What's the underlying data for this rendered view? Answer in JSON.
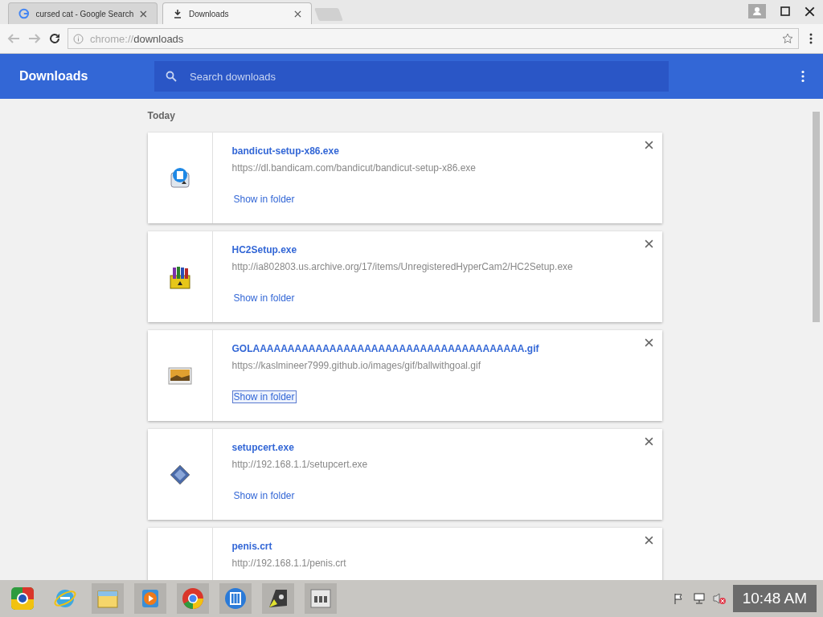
{
  "tabs": [
    {
      "title": "cursed cat - Google Search",
      "kind": "google",
      "selected": false
    },
    {
      "title": "Downloads",
      "kind": "download",
      "selected": true
    }
  ],
  "address_bar": {
    "url_scheme": "chrome://",
    "url_path": "downloads"
  },
  "header": {
    "title": "Downloads",
    "search": {
      "placeholder": "Search downloads"
    }
  },
  "section": "Today",
  "downloads": [
    {
      "name": "bandicut-setup-x86.exe",
      "url": "https://dl.bandicam.com/bandicut/bandicut-setup-x86.exe",
      "action": "Show in folder",
      "kind": "installer",
      "focused": false
    },
    {
      "name": "HC2Setup.exe",
      "url": "http://ia802803.us.archive.org/17/items/UnregisteredHyperCam2/HC2Setup.exe",
      "action": "Show in folder",
      "kind": "archive",
      "focused": false
    },
    {
      "name": "GOLAAAAAAAAAAAAAAAAAAAAAAAAAAAAAAAAAAAAAAA.gif",
      "url": "https://kaslmineer7999.github.io/images/gif/ballwithgoal.gif",
      "action": "Show in folder",
      "kind": "image",
      "focused": true
    },
    {
      "name": "setupcert.exe",
      "url": "http://192.168.1.1/setupcert.exe",
      "action": "Show in folder",
      "kind": "certificate",
      "focused": false
    },
    {
      "name": "penis.crt",
      "url": "http://192.168.1.1/penis.crt"
    }
  ],
  "taskbar": {
    "apps": [
      {
        "kind": "chrome-alt"
      },
      {
        "kind": "ie"
      },
      {
        "kind": "explorer"
      },
      {
        "kind": "media"
      },
      {
        "kind": "chrome"
      },
      {
        "kind": "video"
      },
      {
        "kind": "cam"
      },
      {
        "kind": "panel"
      }
    ],
    "clock": "10:48 AM"
  }
}
